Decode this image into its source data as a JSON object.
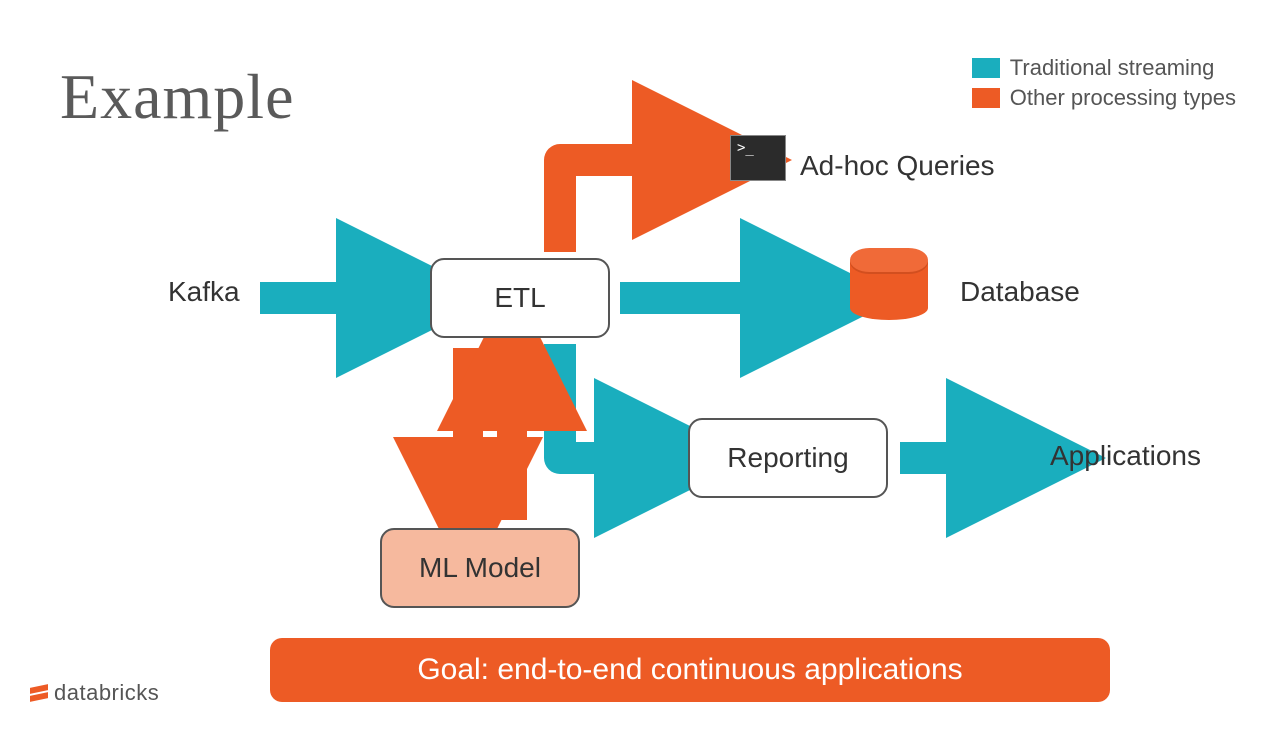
{
  "title": "Example",
  "legend": {
    "teal": "Traditional streaming",
    "orange": "Other processing types"
  },
  "nodes": {
    "kafka": "Kafka",
    "etl": "ETL",
    "ml": "ML Model",
    "report": "Reporting",
    "adhoc": "Ad-hoc Queries",
    "database": "Database",
    "apps": "Applications"
  },
  "goal": "Goal: end-to-end continuous applications",
  "brand": "databricks",
  "terminal_prompt": ">_",
  "colors": {
    "teal": "#1aaebe",
    "orange": "#ed5b25",
    "ml_fill": "#f6b99e"
  },
  "arrows": [
    {
      "from": "kafka",
      "to": "etl",
      "style": "teal"
    },
    {
      "from": "etl",
      "to": "database",
      "style": "teal"
    },
    {
      "from": "etl",
      "to": "report",
      "style": "teal"
    },
    {
      "from": "report",
      "to": "apps",
      "style": "teal"
    },
    {
      "from": "etl",
      "to": "adhoc",
      "style": "orange"
    },
    {
      "from": "etl",
      "to": "ml",
      "style": "orange",
      "bidirectional": true
    }
  ]
}
